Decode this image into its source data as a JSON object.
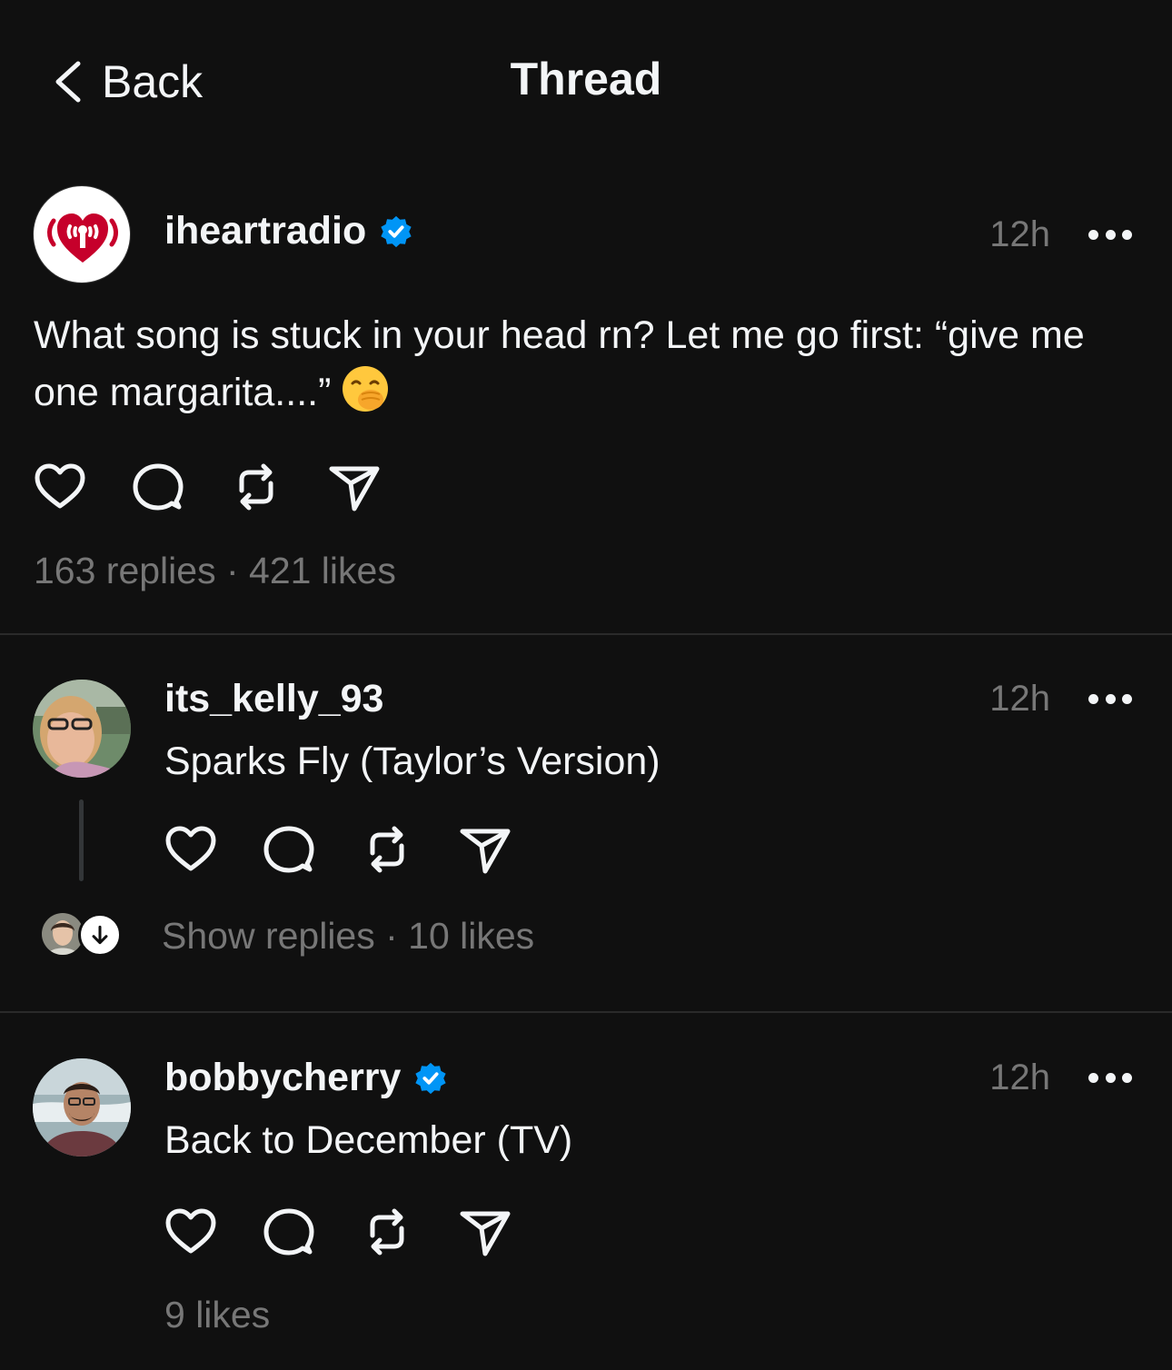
{
  "header": {
    "back_label": "Back",
    "title": "Thread"
  },
  "main_post": {
    "username": "iheartradio",
    "verified": true,
    "time": "12h",
    "text": "What song is stuck in your head rn? Let me go first: “give me one margarita....”",
    "emoji": "face-with-hand-over-mouth",
    "stats": "163 replies · 421 likes"
  },
  "replies": [
    {
      "username": "its_kelly_93",
      "verified": false,
      "time": "12h",
      "text": "Sparks Fly (Taylor’s Version)",
      "stats": "Show replies · 10 likes"
    },
    {
      "username": "bobbycherry",
      "verified": true,
      "time": "12h",
      "text": "Back to December (TV)",
      "stats": "9 likes"
    }
  ],
  "colors": {
    "background": "#101010",
    "text": "#f3f5f7",
    "muted": "#777777",
    "verified": "#0095f6",
    "iheart_red": "#c6002b"
  }
}
